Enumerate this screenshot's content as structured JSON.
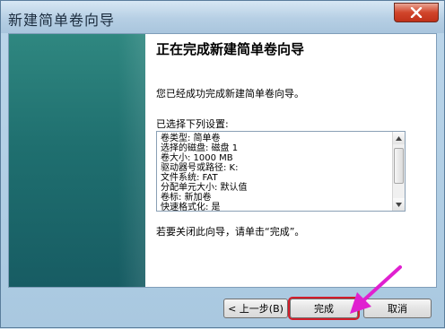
{
  "window": {
    "title": "新建简单卷向导",
    "close_icon": "close-icon"
  },
  "content": {
    "heading": "正在完成新建简单卷向导",
    "success_message": "您已经成功完成新建简单卷向导。",
    "settings_label": "已选择下列设置:",
    "settings_lines": [
      "卷类型: 简单卷",
      "选择的磁盘: 磁盘 1",
      "卷大小: 1000 MB",
      "驱动器号或路径: K:",
      "文件系统: FAT",
      "分配单元大小: 默认值",
      "卷标: 新加卷",
      "快速格式化: 是"
    ],
    "close_hint": "若要关闭此向导，请单击“完成”。"
  },
  "buttons": {
    "back": "< 上一步(B)",
    "finish": "完成",
    "cancel": "取消"
  },
  "colors": {
    "side_panel": "#1f6f6f",
    "annotation_arrow": "#e020d0",
    "highlight": "#d21d2a"
  }
}
